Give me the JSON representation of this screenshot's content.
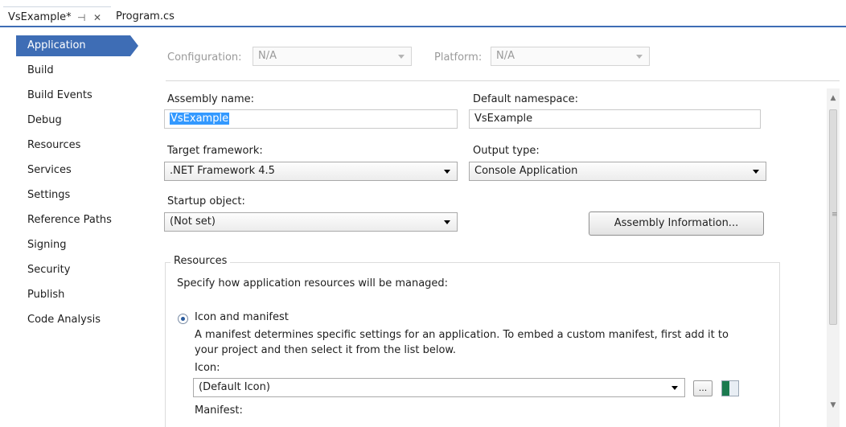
{
  "tabs": {
    "active": {
      "label": "VsExample*",
      "pin": "⊣",
      "close": "✕"
    },
    "inactive": {
      "label": "Program.cs"
    }
  },
  "sidebar": {
    "items": [
      {
        "label": "Application",
        "selected": true
      },
      {
        "label": "Build"
      },
      {
        "label": "Build Events"
      },
      {
        "label": "Debug"
      },
      {
        "label": "Resources"
      },
      {
        "label": "Services"
      },
      {
        "label": "Settings"
      },
      {
        "label": "Reference Paths"
      },
      {
        "label": "Signing"
      },
      {
        "label": "Security"
      },
      {
        "label": "Publish"
      },
      {
        "label": "Code Analysis"
      }
    ]
  },
  "config": {
    "configuration_label": "Configuration:",
    "configuration_value": "N/A",
    "platform_label": "Platform:",
    "platform_value": "N/A"
  },
  "app": {
    "assembly_name_label": "Assembly name:",
    "assembly_name_value": "VsExample",
    "default_namespace_label": "Default namespace:",
    "default_namespace_value": "VsExample",
    "target_framework_label": "Target framework:",
    "target_framework_value": ".NET Framework 4.5",
    "output_type_label": "Output type:",
    "output_type_value": "Console Application",
    "startup_object_label": "Startup object:",
    "startup_object_value": "(Not set)",
    "assembly_info_button": "Assembly Information..."
  },
  "resources": {
    "legend": "Resources",
    "description": "Specify how application resources will be managed:",
    "icon_manifest_option": "Icon and manifest",
    "manifest_help_line1": "A manifest determines specific settings for an application. To embed a custom manifest, first add it to",
    "manifest_help_line2": "your project and then select it from the list below.",
    "icon_label": "Icon:",
    "icon_value": "(Default Icon)",
    "browse_button": "...",
    "manifest_label": "Manifest:"
  },
  "scrollbar": {
    "up": "▲",
    "down": "▼",
    "grip": "≡"
  },
  "colors": {
    "accent": "#3e6db5",
    "selection": "#3399ff"
  }
}
